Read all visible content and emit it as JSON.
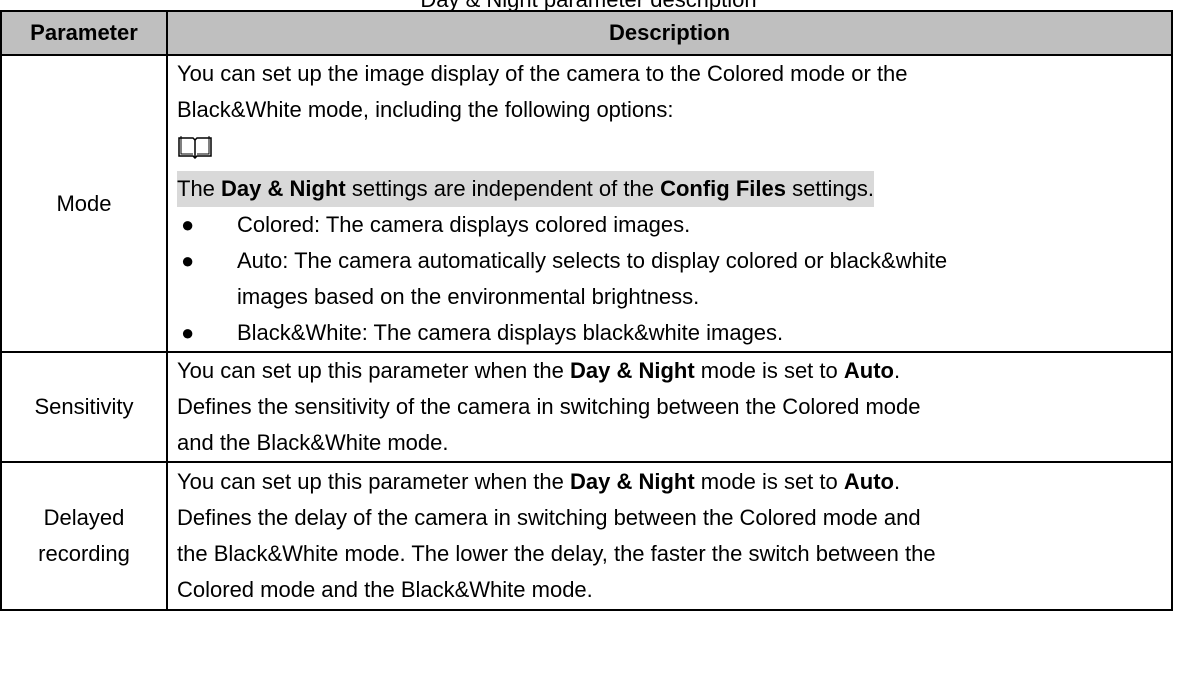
{
  "caption_fragment": "Day & Night parameter description",
  "table": {
    "headers": [
      "Parameter",
      "Description"
    ],
    "rows": [
      {
        "name": "Mode",
        "intro_1": "You can set up the image display of the camera to the Colored mode or the",
        "intro_2": "Black&White mode, including the following options:",
        "note_icon": "book-icon",
        "note_parts": [
          "The ",
          "Day & Night",
          " settings are independent of the ",
          "Config Files",
          " settings."
        ],
        "bullets": [
          {
            "lines": [
              "Colored: The camera displays colored images."
            ]
          },
          {
            "lines": [
              "Auto: The camera automatically selects to display colored or black&white",
              "images based on the environmental brightness."
            ]
          },
          {
            "lines": [
              "Black&White: The camera displays black&white images."
            ]
          }
        ]
      },
      {
        "name": "Sensitivity",
        "line1_parts": [
          "You can set up this parameter when the ",
          "Day & Night",
          " mode is set to ",
          "Auto",
          "."
        ],
        "line2": "Defines the sensitivity of the camera in switching between the Colored mode",
        "line3": "and the Black&White mode."
      },
      {
        "name_1": "Delayed",
        "name_2": "recording",
        "line1_parts": [
          "You can set up this parameter when the ",
          "Day & Night",
          " mode is set to ",
          "Auto",
          "."
        ],
        "line2": "Defines the delay of the camera in switching between the Colored mode and",
        "line3": "the Black&White mode. The lower the delay, the faster the switch between the",
        "line4": "Colored mode and the Black&White mode."
      }
    ]
  }
}
